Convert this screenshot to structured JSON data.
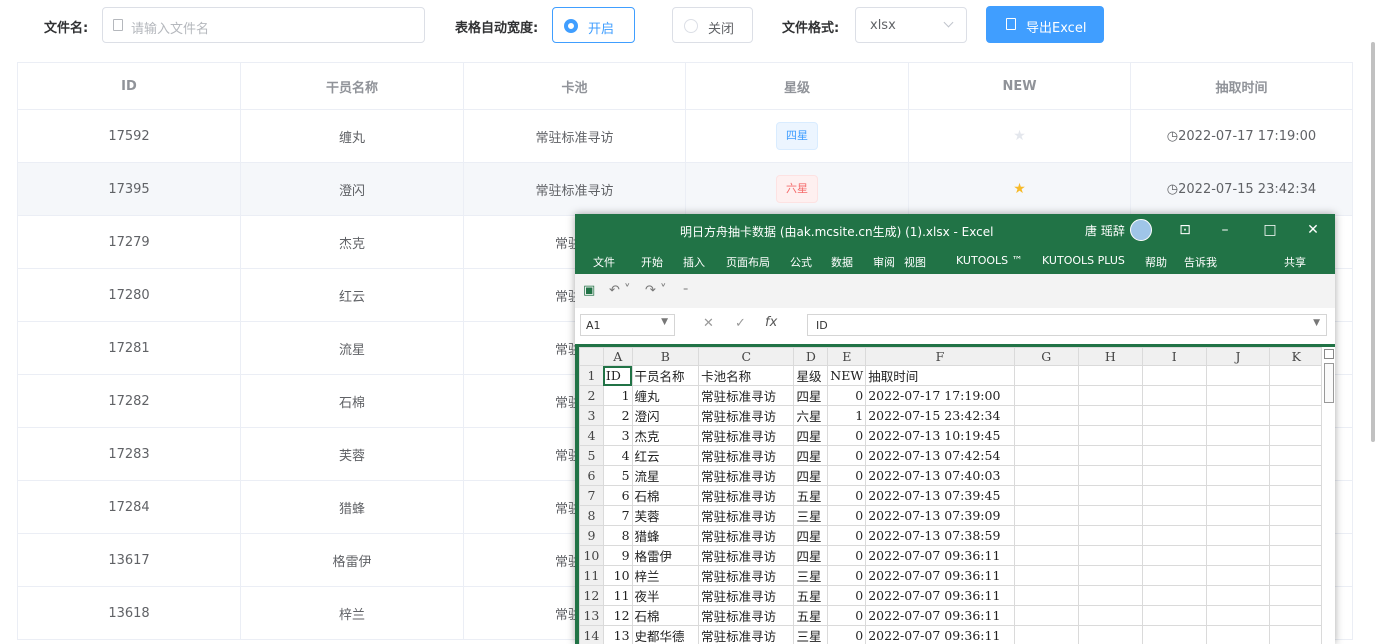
{
  "toolbar": {
    "filename_label": "文件名:",
    "filename_placeholder": "请输入文件名",
    "autowidth_label": "表格自动宽度:",
    "radio_on": "开启",
    "radio_off": "关闭",
    "format_label": "文件格式:",
    "format_value": "xlsx",
    "export_label": "导出Excel"
  },
  "table": {
    "headers": [
      "ID",
      "干员名称",
      "卡池",
      "星级",
      "NEW",
      "抽取时间"
    ],
    "rows": [
      {
        "id": "17592",
        "name": "缠丸",
        "pool": "常驻标准寻访",
        "rarity": "四星",
        "rarity_color": "blue",
        "new": false,
        "time": "2022-07-17 17:19:00"
      },
      {
        "id": "17395",
        "name": "澄闪",
        "pool": "常驻标准寻访",
        "rarity": "六星",
        "rarity_color": "red",
        "new": true,
        "time": "2022-07-15 23:42:34"
      },
      {
        "id": "17279",
        "name": "杰克",
        "pool": "常驻标"
      },
      {
        "id": "17280",
        "name": "红云",
        "pool": "常驻标"
      },
      {
        "id": "17281",
        "name": "流星",
        "pool": "常驻标"
      },
      {
        "id": "17282",
        "name": "石棉",
        "pool": "常驻标"
      },
      {
        "id": "17283",
        "name": "芙蓉",
        "pool": "常驻标"
      },
      {
        "id": "17284",
        "name": "猎蜂",
        "pool": "常驻标"
      },
      {
        "id": "13617",
        "name": "格雷伊",
        "pool": "常驻标"
      },
      {
        "id": "13618",
        "name": "梓兰",
        "pool": "常驻标"
      }
    ]
  },
  "excel": {
    "title": "明日方舟抽卡数据 (由ak.mcsite.cn生成) (1).xlsx - Excel",
    "user": "唐 瑶辞",
    "menu": [
      "文件",
      "开始",
      "插入",
      "页面布局",
      "公式",
      "数据",
      "审阅",
      "视图",
      "KUTOOLS ™",
      "KUTOOLS PLUS",
      "帮助",
      "告诉我",
      "共享"
    ],
    "name_box": "A1",
    "formula": "ID",
    "fx": "fx",
    "columns": [
      "A",
      "B",
      "C",
      "D",
      "E",
      "F",
      "G",
      "H",
      "I",
      "J",
      "K"
    ],
    "rows": [
      [
        "1",
        "ID",
        "干员名称",
        "卡池名称",
        "星级",
        "NEW",
        "抽取时间"
      ],
      [
        "2",
        "1",
        "缠丸",
        "常驻标准寻访",
        "四星",
        "0",
        "2022-07-17 17:19:00"
      ],
      [
        "3",
        "2",
        "澄闪",
        "常驻标准寻访",
        "六星",
        "1",
        "2022-07-15 23:42:34"
      ],
      [
        "4",
        "3",
        "杰克",
        "常驻标准寻访",
        "四星",
        "0",
        "2022-07-13 10:19:45"
      ],
      [
        "5",
        "4",
        "红云",
        "常驻标准寻访",
        "四星",
        "0",
        "2022-07-13 07:42:54"
      ],
      [
        "6",
        "5",
        "流星",
        "常驻标准寻访",
        "四星",
        "0",
        "2022-07-13 07:40:03"
      ],
      [
        "7",
        "6",
        "石棉",
        "常驻标准寻访",
        "五星",
        "0",
        "2022-07-13 07:39:45"
      ],
      [
        "8",
        "7",
        "芙蓉",
        "常驻标准寻访",
        "三星",
        "0",
        "2022-07-13 07:39:09"
      ],
      [
        "9",
        "8",
        "猎蜂",
        "常驻标准寻访",
        "四星",
        "0",
        "2022-07-13 07:38:59"
      ],
      [
        "10",
        "9",
        "格雷伊",
        "常驻标准寻访",
        "四星",
        "0",
        "2022-07-07 09:36:11"
      ],
      [
        "11",
        "10",
        "梓兰",
        "常驻标准寻访",
        "三星",
        "0",
        "2022-07-07 09:36:11"
      ],
      [
        "12",
        "11",
        "夜半",
        "常驻标准寻访",
        "五星",
        "0",
        "2022-07-07 09:36:11"
      ],
      [
        "13",
        "12",
        "石棉",
        "常驻标准寻访",
        "五星",
        "0",
        "2022-07-07 09:36:11"
      ],
      [
        "14",
        "13",
        "史都华德",
        "常驻标准寻访",
        "三星",
        "0",
        "2022-07-07 09:36:11"
      ]
    ]
  },
  "colors": {
    "primary": "#409eff",
    "excel_green": "#217346",
    "star_on": "#f7ba2a",
    "tag_red": "#f56c6c"
  }
}
